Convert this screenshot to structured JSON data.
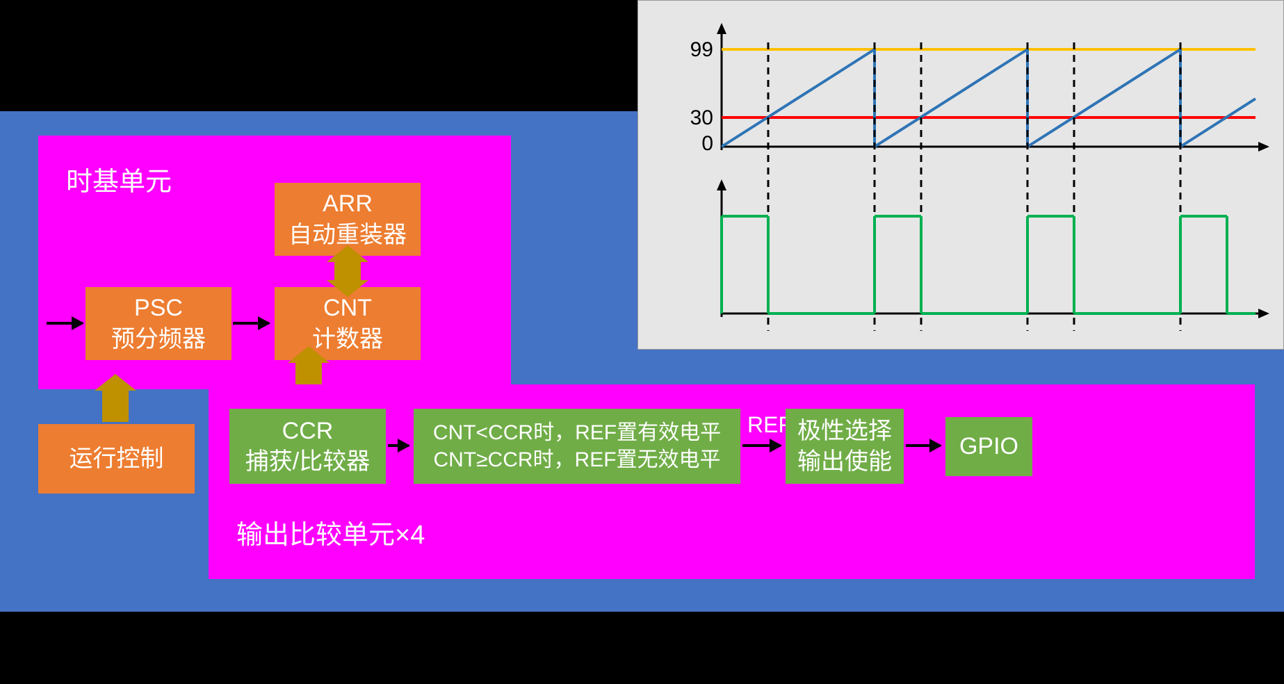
{
  "timebase": {
    "title": "时基单元",
    "psc": {
      "line1": "PSC",
      "line2": "预分频器"
    },
    "cnt": {
      "line1": "CNT",
      "line2": "计数器"
    },
    "arr": {
      "line1": "ARR",
      "line2": "自动重装器"
    }
  },
  "run_control": "运行控制",
  "oc": {
    "title": "输出比较单元×4",
    "ccr": {
      "line1": "CCR",
      "line2": "捕获/比较器"
    },
    "logic": {
      "line1": "CNT<CCR时，REF置有效电平",
      "line2": "CNT≥CCR时，REF置无效电平"
    },
    "ref": "REF",
    "polarity": {
      "line1": "极性选择",
      "line2": "输出使能"
    },
    "gpio": "GPIO"
  },
  "chart_data": {
    "type": "line",
    "title": "",
    "top_plot": {
      "ylabels": {
        "max": "99",
        "threshold": "30",
        "zero": "0"
      },
      "arr_value": 99,
      "ccr_value": 30,
      "periods": 3.5,
      "description": "CNT counts 0→99 repeatedly (sawtooth). Yellow line at 99 (ARR). Red line at 30 (CCR). Dashed vertical lines at each CCR match and each overflow."
    },
    "bottom_plot": {
      "description": "REF output: HIGH while CNT<CCR (30), LOW while CNT≥CCR, for 3 full periods + partial 4th.",
      "duty_cycle_percent": 30
    }
  }
}
